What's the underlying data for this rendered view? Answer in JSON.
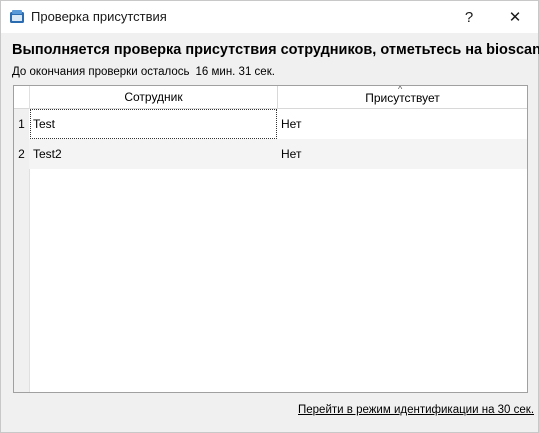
{
  "window": {
    "title": "Проверка присутствия",
    "help_symbol": "?",
    "close_symbol": "✕"
  },
  "header": {
    "message": "Выполняется проверка присутствия сотрудников, отметьтесь на bioscan",
    "countdown_label": "До окончания проверки осталось",
    "countdown_value": "16 мин. 31 сек."
  },
  "table": {
    "columns": [
      "Сотрудник",
      "Присутствует"
    ],
    "sort_indicator": "^",
    "rows": [
      {
        "num": "1",
        "name": "Test",
        "present": "Нет"
      },
      {
        "num": "2",
        "name": "Test2",
        "present": "Нет"
      }
    ]
  },
  "footer": {
    "ident_link": "Перейти в режим идентификации на 30 сек."
  },
  "icons": {
    "app": "window-app-icon",
    "help": "help-icon",
    "close": "close-icon"
  },
  "colors": {
    "app_icon": "#2b6cb0",
    "background": "#f0f0f0",
    "alt_row": "#f4f4f4"
  }
}
